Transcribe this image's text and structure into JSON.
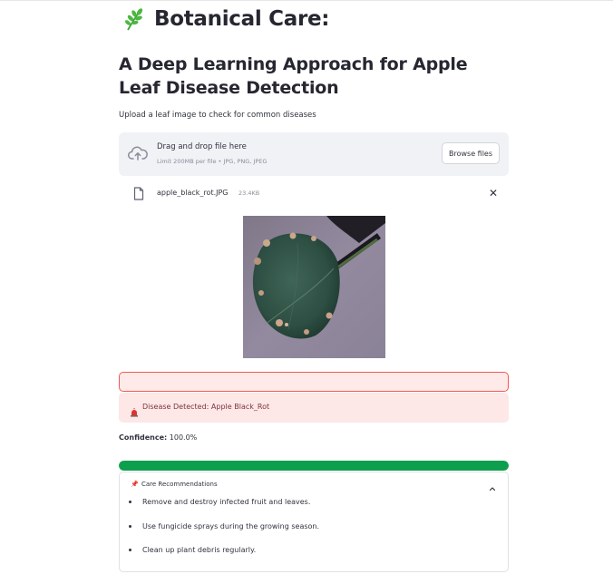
{
  "header": {
    "title": "Botanical Care:",
    "title_icon": "herb-icon",
    "subtitle": "A Deep Learning Approach for Apple Leaf Disease Detection"
  },
  "upload": {
    "caption": "Upload a leaf image to check for common diseases",
    "drop_title": "Drag and drop file here",
    "drop_subtitle": "Limit 200MB per file • JPG, PNG, JPEG",
    "browse_label": "Browse files",
    "file": {
      "name": "apple_black_rot.JPG",
      "size": "23.4KB"
    }
  },
  "result": {
    "alert_text": "Disease Detected: Apple Black_Rot",
    "confidence_label": "Confidence:",
    "confidence_value": "100.0%",
    "progress": 1.0
  },
  "care": {
    "title": "Care Recommendations",
    "items": [
      "Remove and destroy infected fruit and leaves.",
      "Use fungicide sprays during the growing season.",
      "Clean up plant debris regularly."
    ]
  },
  "colors": {
    "accent_green": "#0d9f4e",
    "error_border": "#f05a4f",
    "alert_bg": "#fde7e7",
    "alert_text": "#7d353b"
  }
}
